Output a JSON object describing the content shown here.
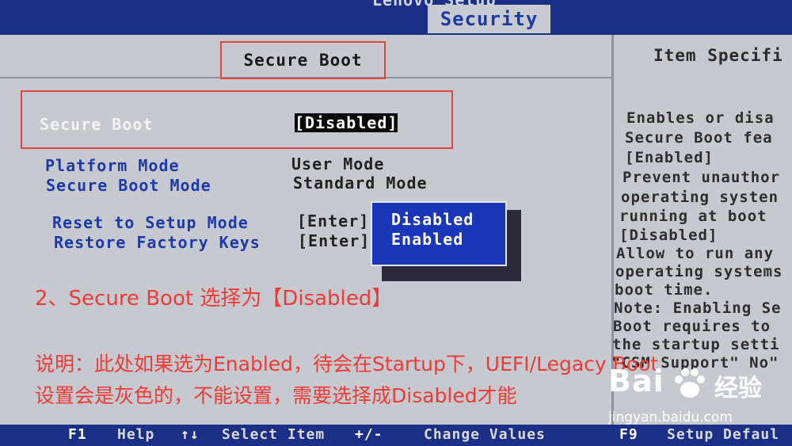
{
  "header": {
    "title": "Lenovo Setup",
    "active_tab": "Security"
  },
  "section_title": "Secure Boot",
  "settings": [
    {
      "label": "Platform Mode",
      "value": "User Mode"
    },
    {
      "label": "Secure Boot Mode",
      "value": "Standard Mode"
    }
  ],
  "selected_setting": {
    "label": "Secure Boot",
    "value": "[Disabled]"
  },
  "actions": [
    {
      "label": "Reset to Setup Mode",
      "value": "[Enter]"
    },
    {
      "label": "Restore Factory Keys",
      "value": "[Enter]"
    }
  ],
  "popup": {
    "options": [
      "Disabled",
      "Enabled"
    ],
    "selected": "Disabled"
  },
  "help_panel": {
    "title": "Item Specifi",
    "lines": [
      "Enables or disa",
      "Secure Boot fea",
      "[Enabled]",
      "Prevent unauthor",
      "operating systen",
      "running at boot",
      "[Disabled]",
      "Allow to run any",
      "operating systems",
      "boot time.",
      "Note: Enabling Se",
      "Boot requires to",
      "the startup setti",
      "\"CSM Support\" No\""
    ]
  },
  "annotation": {
    "line1": "2、Secure Boot 选择为【Disabled】",
    "line2": "说明：此处如果选为Enabled，待会在Startup下，UEFI/Legacy Boot",
    "line3": "设置会是灰色的，不能设置，需要选择成Disabled才能"
  },
  "footer": [
    {
      "key": "F1",
      "desc": "Help"
    },
    {
      "key": "↑↓",
      "desc": "Select Item"
    },
    {
      "key": "+/-",
      "desc": "Change Values"
    },
    {
      "key": "F9",
      "desc": "Setup Defaul"
    }
  ],
  "watermark": {
    "logo": "Bai",
    "logo_cn": "经验",
    "url": "jingyan.baidu.com"
  },
  "colors": {
    "bios_blue": "#1b2f86",
    "panel_gray": "#c6c9cf",
    "highlight_red": "#e0463f",
    "label_blue": "#1d3aa8"
  }
}
